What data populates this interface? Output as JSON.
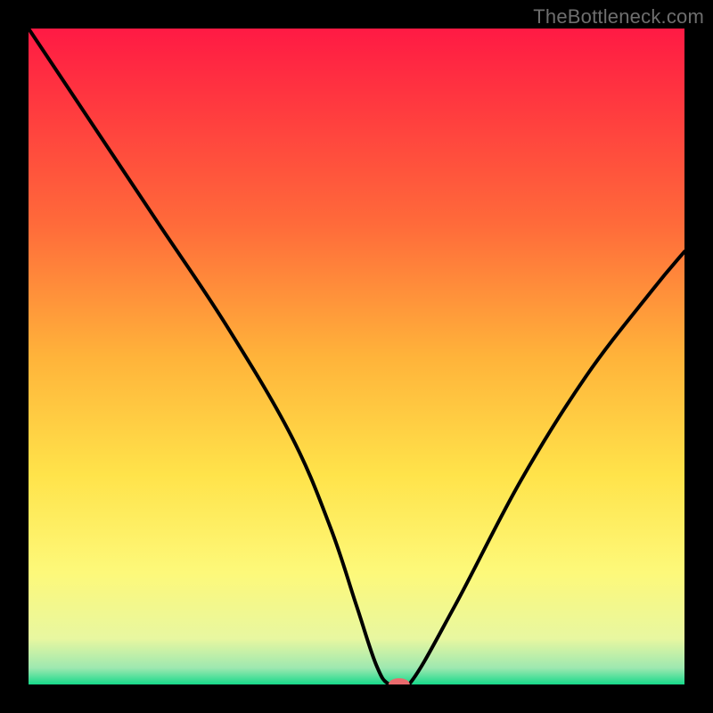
{
  "attribution": "TheBottleneck.com",
  "chart_data": {
    "type": "line",
    "title": "",
    "xlabel": "",
    "ylabel": "",
    "xlim": [
      0,
      100
    ],
    "ylim": [
      0,
      100
    ],
    "series": [
      {
        "name": "curve",
        "x": [
          0,
          12,
          20,
          30,
          40,
          46,
          50,
          53,
          55,
          58,
          65,
          75,
          85,
          95,
          100
        ],
        "values": [
          100,
          82,
          70,
          55,
          38,
          24,
          12,
          3,
          0,
          0,
          12,
          31,
          47,
          60,
          66
        ]
      }
    ],
    "marker": {
      "x": 56.5,
      "y": 0,
      "color": "#ea6a6d",
      "rx": 12,
      "ry": 7
    },
    "gradient_stops": [
      {
        "offset": 0.0,
        "color": "#ff1a44"
      },
      {
        "offset": 0.12,
        "color": "#ff3a3f"
      },
      {
        "offset": 0.3,
        "color": "#ff6b3a"
      },
      {
        "offset": 0.5,
        "color": "#ffb33a"
      },
      {
        "offset": 0.68,
        "color": "#ffe34a"
      },
      {
        "offset": 0.83,
        "color": "#fdf97a"
      },
      {
        "offset": 0.93,
        "color": "#e8f7a0"
      },
      {
        "offset": 0.975,
        "color": "#9de8b0"
      },
      {
        "offset": 1.0,
        "color": "#17d98a"
      }
    ]
  }
}
